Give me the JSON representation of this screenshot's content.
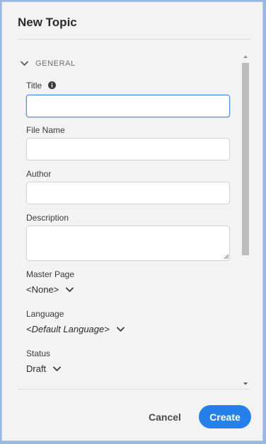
{
  "dialog": {
    "title": "New Topic"
  },
  "section": {
    "label": "GENERAL"
  },
  "fields": {
    "title": {
      "label": "Title",
      "value": ""
    },
    "file_name": {
      "label": "File Name",
      "value": ""
    },
    "author": {
      "label": "Author",
      "value": ""
    },
    "description": {
      "label": "Description",
      "value": ""
    },
    "master_page": {
      "label": "Master Page",
      "value": "<None>"
    },
    "language": {
      "label": "Language",
      "value": "<Default Language>"
    },
    "status": {
      "label": "Status",
      "value": "Draft"
    }
  },
  "buttons": {
    "cancel": "Cancel",
    "create": "Create"
  },
  "colors": {
    "accent": "#2680eb",
    "focus_border": "#4a8ee6",
    "background": "#f3f3f3"
  },
  "icons": {
    "section_toggle": "chevron-down-icon",
    "title_info": "info-icon",
    "dropdown": "chevron-down-icon"
  }
}
